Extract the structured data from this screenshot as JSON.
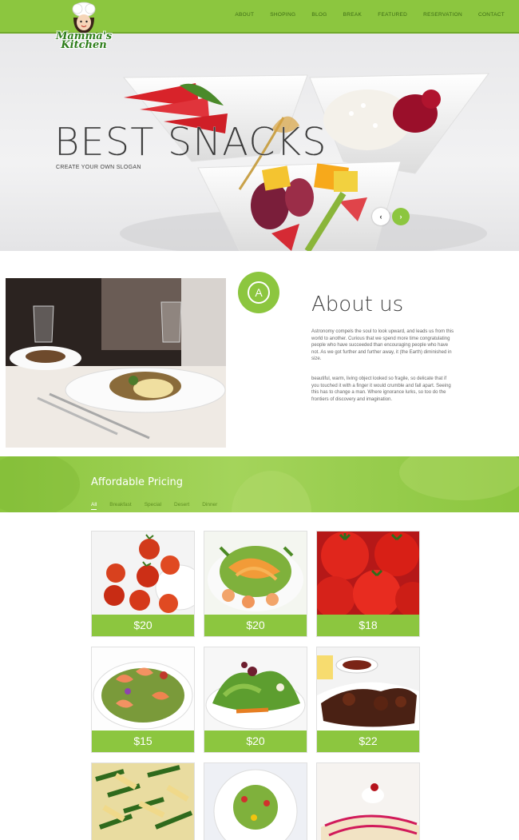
{
  "brand": {
    "logo_text": "Mamma's Kitchen"
  },
  "nav": {
    "items": [
      "About",
      "Shoping",
      "Blog",
      "Break",
      "Featured",
      "Reservation",
      "Contact"
    ]
  },
  "hero": {
    "title": "BEST SNACKS",
    "subtitle": "CREATE YOUR OWN SLOGAN",
    "prev_label": "‹",
    "next_label": "›"
  },
  "about": {
    "badge_letter": "A",
    "title": "About us",
    "paragraph1": "Astronomy compels the soul to look upward, and leads us from this world to another. Curious that we spend more time congratulating people who have succeeded than encouraging people who have not. As we got further and further away, it (the Earth) diminished in size.",
    "paragraph2": "beautiful, warm, living object looked so fragile, so delicate that if you touched it with a finger it would crumble and fall apart. Seeing this has to change a man. Where ignorance lurks, so too do the frontiers of discovery and imagination."
  },
  "pricing": {
    "title": "Affordable Pricing",
    "filters": [
      "All",
      "Breakfast",
      "Special",
      "Desert",
      "Dinner"
    ],
    "items": [
      {
        "price": "$20",
        "dish": "cherry tomatoes"
      },
      {
        "price": "$20",
        "dish": "shrimp noodle salad"
      },
      {
        "price": "$18",
        "dish": "red tomatoes"
      },
      {
        "price": "$15",
        "dish": "shrimp salad"
      },
      {
        "price": "$20",
        "dish": "green salad"
      },
      {
        "price": "$22",
        "dish": "grilled meat with sauce"
      },
      {
        "price": "",
        "dish": "penne with green beans"
      },
      {
        "price": "",
        "dish": "side salad plate"
      },
      {
        "price": "",
        "dish": "crepes with cream"
      }
    ]
  },
  "colors": {
    "accent": "#8cc63f",
    "accent_dark": "#6fa82b",
    "text_dark": "#444444"
  }
}
